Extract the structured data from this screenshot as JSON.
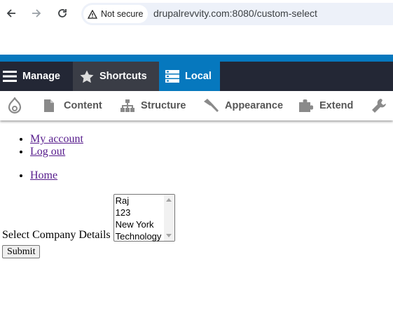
{
  "browser": {
    "security_label": "Not secure",
    "url": "drupalrevvity.com:8080/custom-select"
  },
  "toolbar": {
    "manage_label": "Manage",
    "shortcuts_label": "Shortcuts",
    "local_label": "Local",
    "accent_blue": "#0678be",
    "dark_bg": "#232735"
  },
  "admin_menu": {
    "content_label": "Content",
    "structure_label": "Structure",
    "appearance_label": "Appearance",
    "extend_label": "Extend"
  },
  "user_menu": {
    "items": [
      "My account",
      "Log out"
    ]
  },
  "main_menu": {
    "items": [
      "Home"
    ]
  },
  "form": {
    "label": "Select Company Details",
    "options": [
      "Raj",
      "123",
      "New York",
      "Technology"
    ],
    "submit_label": "Submit"
  }
}
